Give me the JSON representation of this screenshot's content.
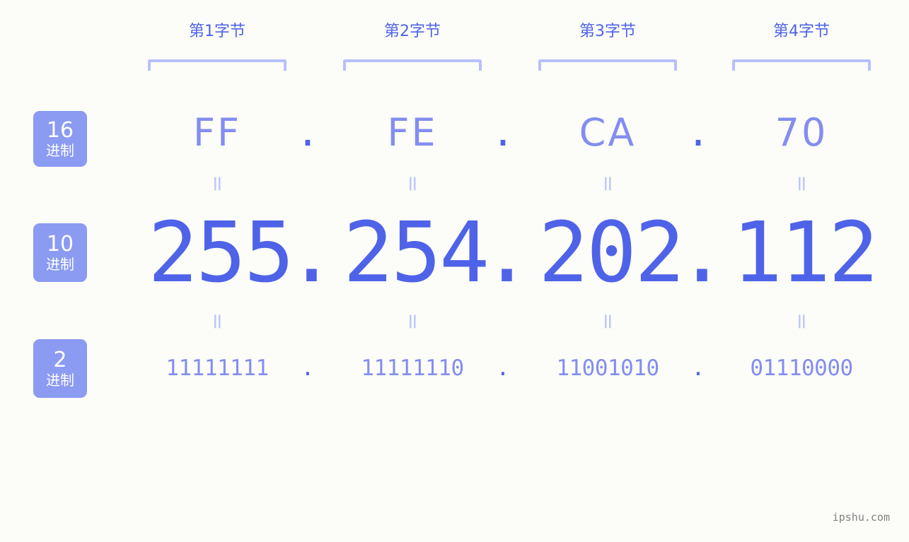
{
  "page": {
    "background_color": "#fcfdf8",
    "watermark": "ipshu.com"
  },
  "colors": {
    "badge_bg": "#8b9bf2",
    "badge_text": "#ffffff",
    "header_label": "#4f63e8",
    "bracket": "#b7c0fb",
    "hex_value": "#838df1",
    "decimal_value": "#4f63e8",
    "binary_value": "#838df1",
    "equals_mark": "#bfc7fb",
    "separator_dot": "#4f63e8",
    "watermark": "#808080"
  },
  "byte_headers": [
    {
      "label": "第1字节"
    },
    {
      "label": "第2字节"
    },
    {
      "label": "第3字节"
    },
    {
      "label": "第4字节"
    }
  ],
  "rows": {
    "hex": {
      "badge_number": "16",
      "badge_word": "进制",
      "values": [
        "FF",
        "FE",
        "CA",
        "70"
      ],
      "separator": "."
    },
    "decimal": {
      "badge_number": "10",
      "badge_word": "进制",
      "values": [
        "255",
        "254",
        "202",
        "112"
      ],
      "separator": "."
    },
    "binary": {
      "badge_number": "2",
      "badge_word": "进制",
      "values": [
        "11111111",
        "11111110",
        "11001010",
        "01110000"
      ],
      "separator": "."
    }
  },
  "equals_marks": {
    "glyph": "=",
    "top_row_count": 4,
    "bottom_row_count": 4
  },
  "address": {
    "hex": "FF.FE.CA.70",
    "decimal": "255.254.202.112",
    "binary": "11111111.11111110.11001010.01110000"
  }
}
